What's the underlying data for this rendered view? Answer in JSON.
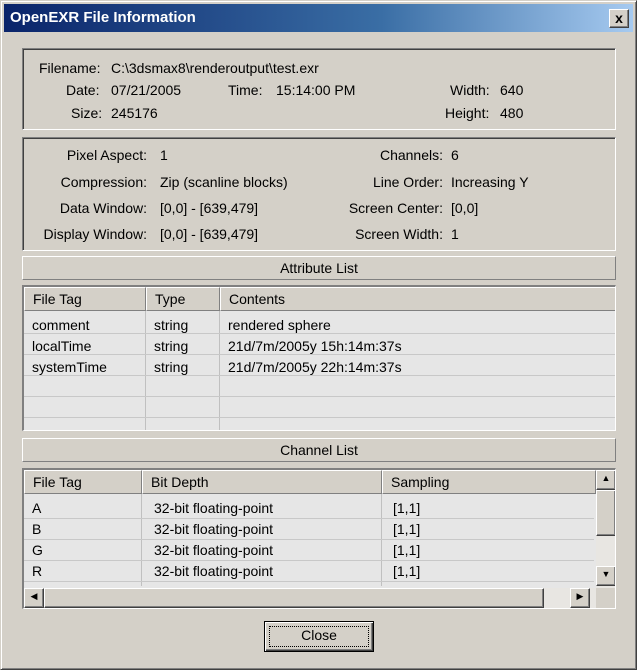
{
  "window": {
    "title": "OpenEXR File Information",
    "close_glyph": "x"
  },
  "file_info": {
    "filename_label": "Filename:",
    "filename_value": "C:\\3dsmax8\\renderoutput\\test.exr",
    "date_label": "Date:",
    "date_value": "07/21/2005",
    "time_label": "Time:",
    "time_value": "15:14:00 PM",
    "width_label": "Width:",
    "width_value": "640",
    "size_label": "Size:",
    "size_value": "245176",
    "height_label": "Height:",
    "height_value": "480"
  },
  "image_info": {
    "pixel_aspect_label": "Pixel Aspect:",
    "pixel_aspect_value": "1",
    "channels_label": "Channels:",
    "channels_value": "6",
    "compression_label": "Compression:",
    "compression_value": "Zip (scanline blocks)",
    "line_order_label": "Line Order:",
    "line_order_value": "Increasing Y",
    "data_window_label": "Data Window:",
    "data_window_value": "[0,0] - [639,479]",
    "screen_center_label": "Screen Center:",
    "screen_center_value": "[0,0]",
    "display_window_label": "Display Window:",
    "display_window_value": "[0,0] - [639,479]",
    "screen_width_label": "Screen Width:",
    "screen_width_value": "1"
  },
  "attribute_list": {
    "header": "Attribute List",
    "columns": [
      "File Tag",
      "Type",
      "Contents"
    ],
    "rows": [
      [
        "comment",
        "string",
        "rendered sphere"
      ],
      [
        "localTime",
        "string",
        "21d/7m/2005y  15h:14m:37s"
      ],
      [
        "systemTime",
        "string",
        "21d/7m/2005y  22h:14m:37s"
      ]
    ]
  },
  "channel_list": {
    "header": "Channel List",
    "columns": [
      "File Tag",
      "Bit Depth",
      "Sampling"
    ],
    "rows": [
      [
        "A",
        "32-bit floating-point",
        "[1,1]"
      ],
      [
        "B",
        "32-bit floating-point",
        "[1,1]"
      ],
      [
        "G",
        "32-bit floating-point",
        "[1,1]"
      ],
      [
        "R",
        "32-bit floating-point",
        "[1,1]"
      ]
    ]
  },
  "scroll_icons": {
    "up": "▲",
    "down": "▼",
    "left": "◀",
    "right": "▶"
  },
  "buttons": {
    "close_label": "Close"
  }
}
